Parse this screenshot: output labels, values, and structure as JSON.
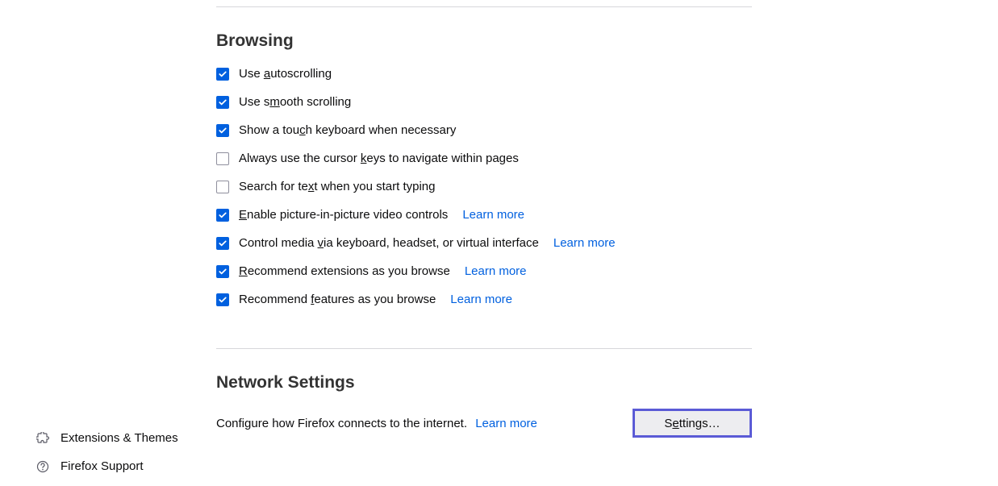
{
  "browsing": {
    "title": "Browsing",
    "options": [
      {
        "checked": true,
        "label_pre": "Use ",
        "mnemonic": "a",
        "label_post": "utoscrolling",
        "learn_more": null
      },
      {
        "checked": true,
        "label_pre": "Use s",
        "mnemonic": "m",
        "label_post": "ooth scrolling",
        "learn_more": null
      },
      {
        "checked": true,
        "label_pre": "Show a tou",
        "mnemonic": "c",
        "label_post": "h keyboard when necessary",
        "learn_more": null
      },
      {
        "checked": false,
        "label_pre": "Always use the cursor ",
        "mnemonic": "k",
        "label_post": "eys to navigate within pages",
        "learn_more": null
      },
      {
        "checked": false,
        "label_pre": "Search for te",
        "mnemonic": "x",
        "label_post": "t when you start typing",
        "learn_more": null
      },
      {
        "checked": true,
        "label_pre": "",
        "mnemonic": "E",
        "label_post": "nable picture-in-picture video controls",
        "learn_more": "Learn more"
      },
      {
        "checked": true,
        "label_pre": "Control media ",
        "mnemonic": "v",
        "label_post": "ia keyboard, headset, or virtual interface",
        "learn_more": "Learn more"
      },
      {
        "checked": true,
        "label_pre": "",
        "mnemonic": "R",
        "label_post": "ecommend extensions as you browse",
        "learn_more": "Learn more"
      },
      {
        "checked": true,
        "label_pre": "Recommend ",
        "mnemonic": "f",
        "label_post": "eatures as you browse",
        "learn_more": "Learn more"
      }
    ]
  },
  "network": {
    "title": "Network Settings",
    "description": "Configure how Firefox connects to the internet.",
    "learn_more": "Learn more",
    "button_pre": "S",
    "button_mnemonic": "e",
    "button_post": "ttings…"
  },
  "sidebar": {
    "extensions": "Extensions & Themes",
    "support": "Firefox Support"
  }
}
